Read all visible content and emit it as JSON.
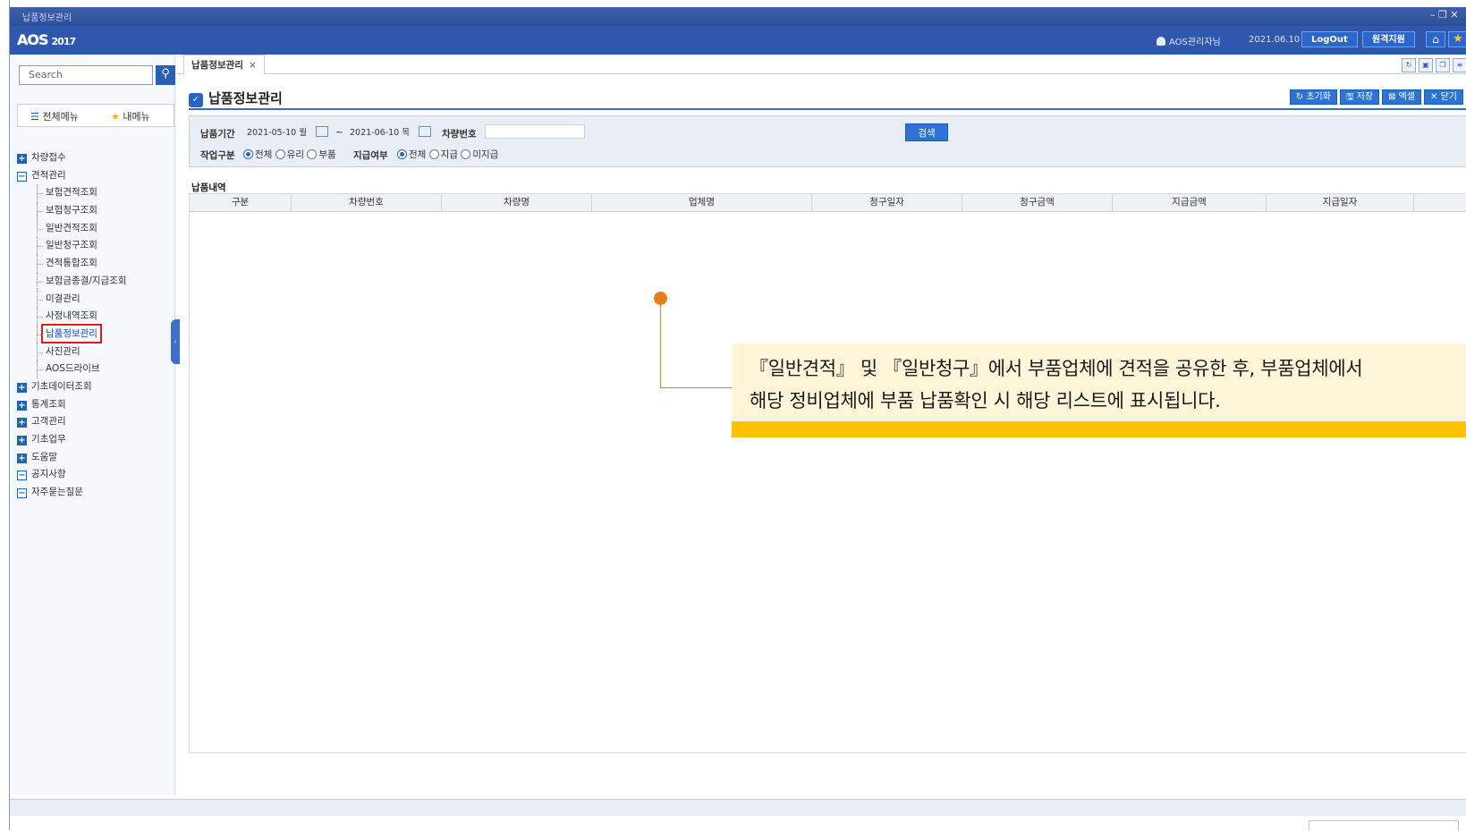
{
  "window": {
    "title": "납품정보관리",
    "controls": "– ❐ ✕"
  },
  "app": {
    "logo": "AOS",
    "year": "2017"
  },
  "header": {
    "user": "AOS관리자님",
    "date": "2021.06.10",
    "logout_label": "LogOut",
    "remote_label": "원격지원"
  },
  "sidebar": {
    "search_placeholder": "Search",
    "menu_all": "전체메뉴",
    "menu_my": "내메뉴",
    "items": [
      {
        "label": "차량접수",
        "type": "plus"
      },
      {
        "label": "견적관리",
        "type": "minus"
      },
      {
        "label": "보험견적조회",
        "type": "child"
      },
      {
        "label": "보험청구조회",
        "type": "child"
      },
      {
        "label": "일반견적조회",
        "type": "child"
      },
      {
        "label": "일반청구조회",
        "type": "child"
      },
      {
        "label": "견적통합조회",
        "type": "child"
      },
      {
        "label": "보험금종결/지급조회",
        "type": "child"
      },
      {
        "label": "미결관리",
        "type": "child"
      },
      {
        "label": "사정내역조회",
        "type": "child"
      },
      {
        "label": "납품정보관리",
        "type": "child",
        "active": true
      },
      {
        "label": "사진관리",
        "type": "child"
      },
      {
        "label": "AOS드라이브",
        "type": "child"
      },
      {
        "label": "기초데이터조회",
        "type": "plus"
      },
      {
        "label": "통계조회",
        "type": "plus"
      },
      {
        "label": "고객관리",
        "type": "plus"
      },
      {
        "label": "기초업무",
        "type": "plus"
      },
      {
        "label": "도움말",
        "type": "plus"
      },
      {
        "label": "공지사항",
        "type": "minus"
      },
      {
        "label": "자주묻는질문",
        "type": "minus"
      }
    ]
  },
  "tab": {
    "label": "납품정보관리",
    "close": "×"
  },
  "page": {
    "title": "납품정보관리",
    "actions": [
      "↻ 초기화",
      "🖫 저장",
      "⊠ 엑셀",
      "✕ 닫기"
    ]
  },
  "filter": {
    "period_label": "납품기간",
    "date_from": "2021-05-10 월",
    "tilde": "~",
    "date_to": "2021-06-10 목",
    "car_no_label": "차량번호",
    "car_no_value": "",
    "search_label": "검색",
    "work_type_label": "작업구분",
    "work_type_options": [
      "전체",
      "유리",
      "부품"
    ],
    "work_type_selected": "전체",
    "pay_label": "지급여부",
    "pay_options": [
      "전체",
      "지급",
      "미지급"
    ],
    "pay_selected": "전체"
  },
  "list": {
    "label": "납품내역",
    "columns": [
      "구분",
      "차량번호",
      "차량명",
      "업체명",
      "청구일자",
      "청구금액",
      "지급금액",
      "지급일자"
    ],
    "rows": []
  },
  "callout": {
    "line1": "『일반견적』 및 『일반청구』에서 부품업체에 견적을 공유한 후, 부품업체에서",
    "line2": "해당 정비업체에 부품 납품확인 시 해당 리스트에 표시됩니다."
  },
  "colors": {
    "accent": "#2f57ad",
    "highlight": "#e01b1b",
    "callout_bar": "#ffc200",
    "callout_bg": "#fff6d9",
    "callout_line": "#e87d1e"
  }
}
